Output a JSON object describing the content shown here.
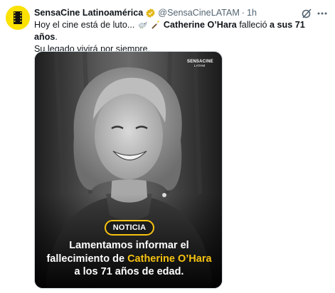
{
  "tweet": {
    "display_name": "SensaCine Latinoamérica",
    "handle": "@SensaCineLATAM",
    "separator": "·",
    "time": "1h",
    "text_part1": "Hoy el cine está de luto...",
    "text_name": "Catherine O’Hara",
    "text_part2": "falleció",
    "text_part3": "a sus",
    "text_age": "71 años",
    "text_part4": ".",
    "text_line2": "Su legado vivirá por siempre."
  },
  "media": {
    "logo_text": "SENSACINE",
    "logo_sub": "LATAM",
    "badge": "NOTICIA",
    "caption_line1": "Lamentamos informar el",
    "caption_line2_prefix": "fallecimiento de",
    "caption_line2_name": "Catherine O’Hara",
    "caption_line3": "a los 71 años de edad."
  },
  "colors": {
    "accent_yellow": "#f7c311",
    "verified_gold": "#e2b719",
    "text_primary": "#0f1419",
    "text_secondary": "#536471"
  },
  "icons": [
    "sensacine-avatar-icon",
    "verified-badge-icon",
    "grok-icon",
    "more-options-icon",
    "dove-emoji-icon",
    "magic-wand-emoji-icon"
  ]
}
